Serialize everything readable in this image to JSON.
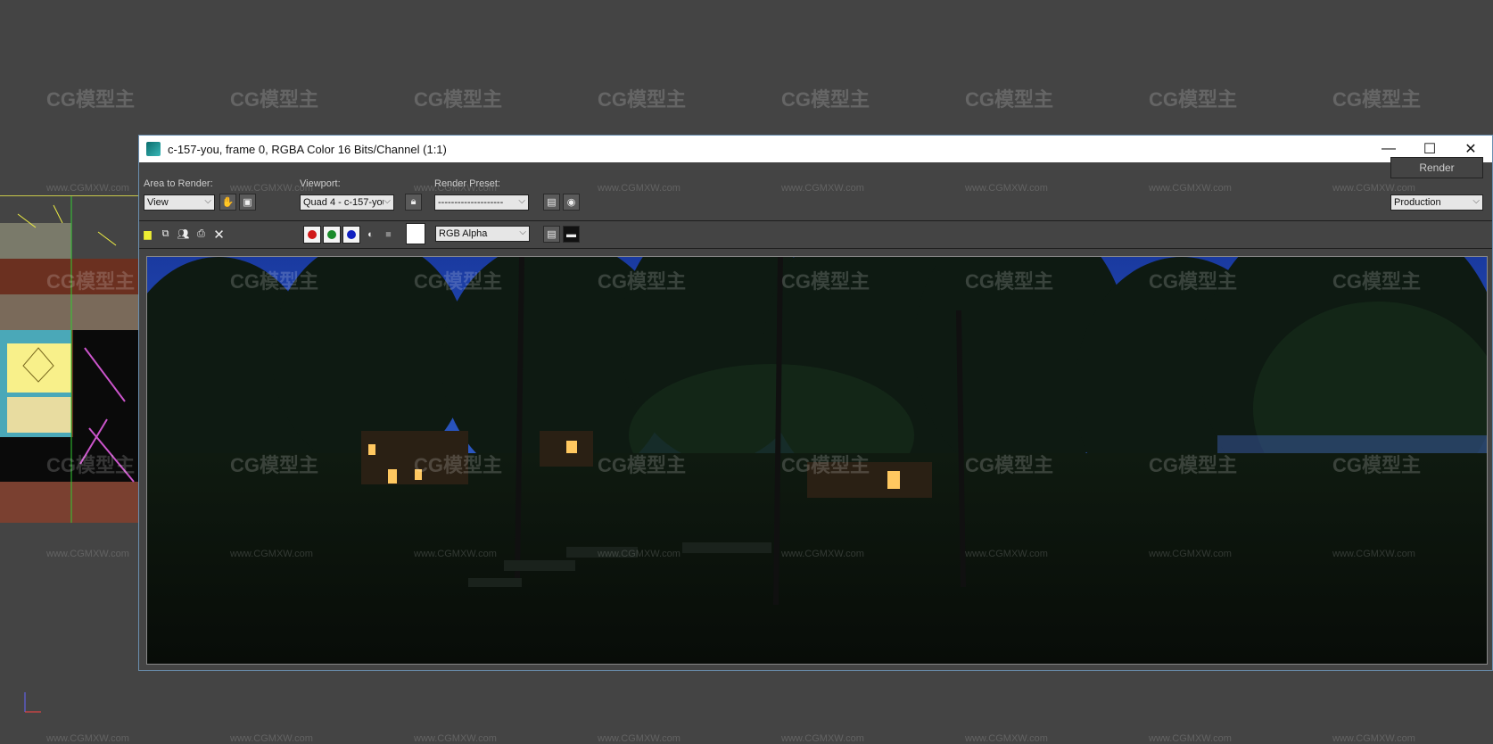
{
  "window": {
    "title": "c-157-you, frame 0, RGBA Color 16 Bits/Channel (1:1)",
    "controls": {
      "minimize": "—",
      "maximize": "☐",
      "close": "✕"
    }
  },
  "toolbar": {
    "area_label": "Area to Render:",
    "area_value": "View",
    "viewport_label": "Viewport:",
    "viewport_value": "Quad 4 - c-157-you",
    "preset_label": "Render Preset:",
    "preset_value": "--------------------",
    "render_button": "Render",
    "mode_value": "Production",
    "channel_value": "RGB Alpha"
  },
  "colors": {
    "red": "#d01818",
    "green": "#1a8a2a",
    "blue": "#1020c0",
    "title_bg": "#ffffff",
    "panel": "#444444"
  },
  "watermark": {
    "logo": "CG模型主",
    "url": "www.CGMXW.com"
  }
}
